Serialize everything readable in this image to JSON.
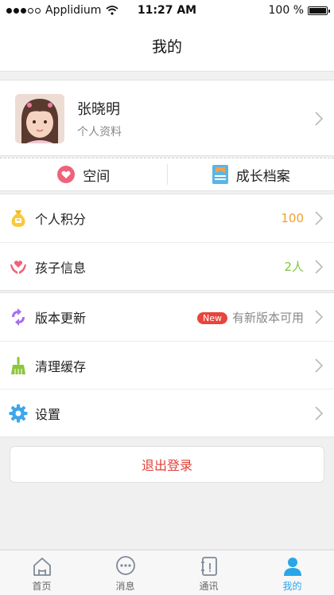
{
  "status_bar": {
    "carrier": "Applidium",
    "time": "11:27 AM",
    "battery": "100 %"
  },
  "nav": {
    "title": "我的"
  },
  "profile": {
    "name": "张晓明",
    "subtitle": "个人资料"
  },
  "shortcuts": [
    {
      "label": "空间",
      "icon": "heart-bubble-icon"
    },
    {
      "label": "成长档案",
      "icon": "archive-card-icon"
    }
  ],
  "group1": [
    {
      "label": "个人积分",
      "value": "100",
      "icon": "money-bag-icon",
      "value_color": "#f0a030"
    },
    {
      "label": "孩子信息",
      "value": "2人",
      "icon": "hands-heart-icon",
      "value_color": "#7fc642"
    }
  ],
  "group2": [
    {
      "label": "版本更新",
      "badge": "New",
      "value": "有新版本可用",
      "icon": "refresh-arrows-icon"
    },
    {
      "label": "清理缓存",
      "value": "",
      "icon": "broom-icon"
    },
    {
      "label": "设置",
      "value": "",
      "icon": "gear-icon"
    }
  ],
  "logout": {
    "label": "退出登录"
  },
  "tabbar": [
    {
      "label": "首页",
      "icon": "home-icon",
      "active": false
    },
    {
      "label": "消息",
      "icon": "chat-bubble-icon",
      "active": false
    },
    {
      "label": "通讯",
      "icon": "contacts-book-icon",
      "active": false
    },
    {
      "label": "我的",
      "icon": "person-icon",
      "active": true
    }
  ],
  "colors": {
    "accent": "#2aa6e8",
    "danger": "#e0413a",
    "badge": "#e8453c"
  }
}
